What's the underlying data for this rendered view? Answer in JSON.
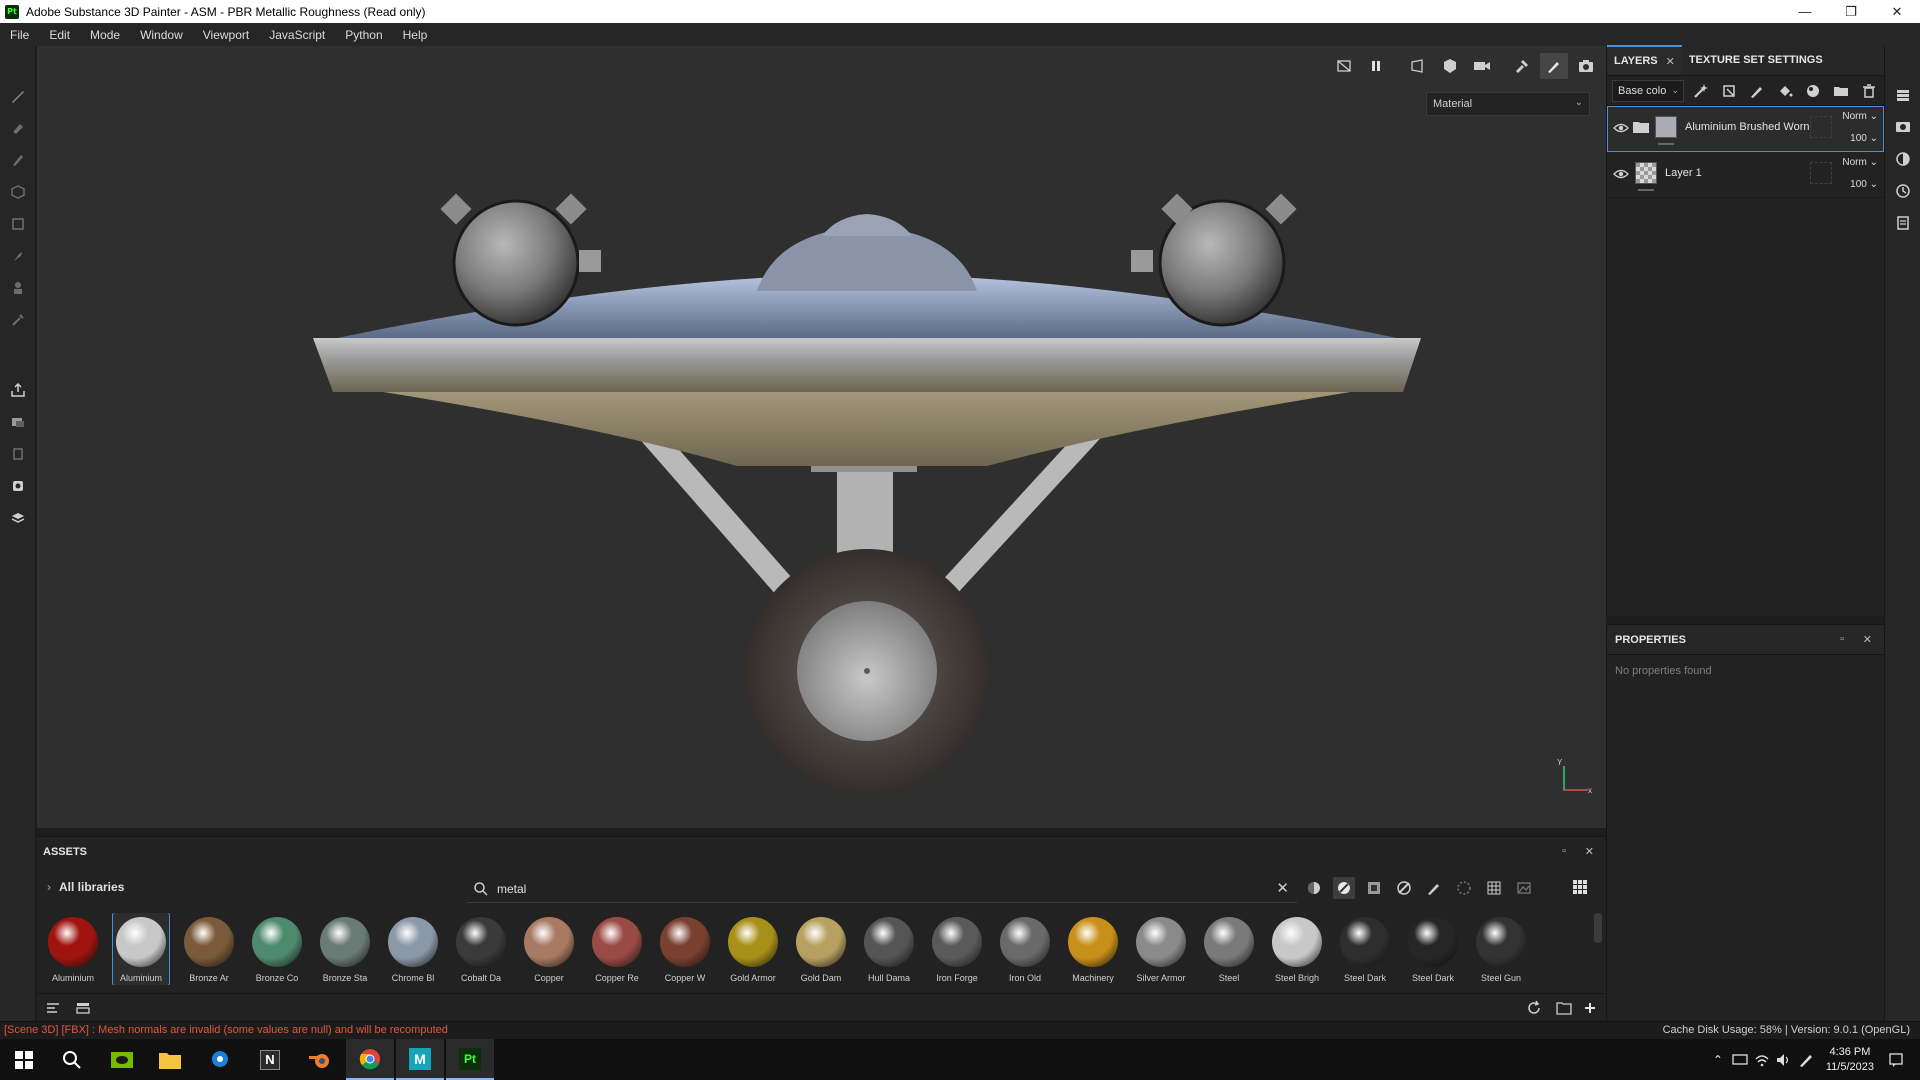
{
  "window": {
    "app_icon_text": "Pt",
    "title": "Adobe Substance 3D Painter - ASM - PBR Metallic Roughness (Read only)",
    "controls": [
      "—",
      "❐",
      "✕"
    ]
  },
  "menu": [
    "File",
    "Edit",
    "Mode",
    "Window",
    "Viewport",
    "JavaScript",
    "Python",
    "Help"
  ],
  "left_tools": [
    "paint-brush-icon",
    "eraser-icon",
    "projection-icon",
    "geometry-mask-icon",
    "polygon-fill-icon",
    "smudge-icon",
    "clone-icon",
    "color-picker-icon",
    "export-icon",
    "bake-icon",
    "uv-icon",
    "screenshot-icon",
    "display-settings-icon"
  ],
  "viewport": {
    "toolbar_icons": [
      "hide-icon",
      "pause-icon",
      "perspective-icon",
      "mesh-view-icon",
      "camera-icon",
      "tool-icon",
      "paint-mode-icon",
      "screenshot-icon"
    ],
    "display_mode": "Material",
    "axis_x": "x",
    "axis_y": "Y"
  },
  "layers": {
    "tabs": [
      {
        "label": "LAYERS",
        "close": "✕"
      },
      {
        "label": "TEXTURE SET SETTINGS"
      }
    ],
    "channel": "Base colo",
    "toolbar_icons": [
      "magic-wand-icon",
      "effects-icon",
      "brush-icon",
      "fill-icon",
      "smart-material-icon",
      "folder-icon",
      "trash-icon"
    ],
    "items": [
      {
        "name": "Aluminium Brushed Worn",
        "blend": "Norm",
        "opacity": "100",
        "type": "folder"
      },
      {
        "name": "Layer 1",
        "blend": "Norm",
        "opacity": "100",
        "type": "paint"
      }
    ]
  },
  "properties": {
    "title": "PROPERTIES",
    "empty": "No properties found"
  },
  "right_strip": [
    "layers-stack-icon",
    "display-icon",
    "shader-icon",
    "history-icon",
    "log-icon"
  ],
  "assets": {
    "title": "ASSETS",
    "path": "All libraries",
    "search_value": "metal",
    "filter_icons": [
      "sphere-filter-icon",
      "material-filter-icon",
      "texture-filter-icon",
      "mask-filter-icon",
      "brush-filter-icon",
      "particle-filter-icon",
      "grid-filter-icon",
      "environment-filter-icon"
    ],
    "items": [
      {
        "label": "Aluminium",
        "color": "#a01410"
      },
      {
        "label": "Aluminium",
        "color": "#c8c8c8"
      },
      {
        "label": "Bronze Ar",
        "color": "#7a5a3a"
      },
      {
        "label": "Bronze Co",
        "color": "#4e8a6e"
      },
      {
        "label": "Bronze Sta",
        "color": "#6a7a74"
      },
      {
        "label": "Chrome Bl",
        "color": "#8a98a8"
      },
      {
        "label": "Cobalt Da",
        "color": "#3a3a3a"
      },
      {
        "label": "Copper",
        "color": "#a87a62"
      },
      {
        "label": "Copper Re",
        "color": "#9a4a44"
      },
      {
        "label": "Copper W",
        "color": "#7a4030"
      },
      {
        "label": "Gold Armor",
        "color": "#a89018"
      },
      {
        "label": "Gold Dam",
        "color": "#b8a060"
      },
      {
        "label": "Hull Dama",
        "color": "#555555"
      },
      {
        "label": "Iron Forge",
        "color": "#5a5a5a"
      },
      {
        "label": "Iron Old",
        "color": "#6a6a6a"
      },
      {
        "label": "Machinery",
        "color": "#c89018"
      },
      {
        "label": "Silver Armor",
        "color": "#8a8a8a"
      },
      {
        "label": "Steel",
        "color": "#7a7a7a"
      },
      {
        "label": "Steel Brigh",
        "color": "#c8c8c8"
      },
      {
        "label": "Steel Dark",
        "color": "#2e2e2e"
      },
      {
        "label": "Steel Dark",
        "color": "#262626"
      },
      {
        "label": "Steel Gun",
        "color": "#333333"
      }
    ]
  },
  "status": {
    "message": "[Scene 3D] [FBX] : Mesh normals are invalid (some values are null) and will be recomputed",
    "right": "Cache Disk Usage:    58% | Version: 9.0.1 (OpenGL)"
  },
  "taskbar": {
    "apps": [
      "windows-start-icon",
      "search-icon",
      "nvidia-icon",
      "file-explorer-icon",
      "sourcetree-icon",
      "notion-icon",
      "blender-icon",
      "chrome-icon",
      "maya-icon",
      "substance-painter-icon"
    ],
    "app_texts": {
      "notion": "N",
      "maya": "M",
      "painter": "Pt"
    },
    "time": "4:36 PM",
    "date": "11/5/2023"
  },
  "colors": {
    "accent": "#4a90d9",
    "error": "#e0573a",
    "panel": "#222222",
    "viewport_bg": "#2f2f2f"
  }
}
